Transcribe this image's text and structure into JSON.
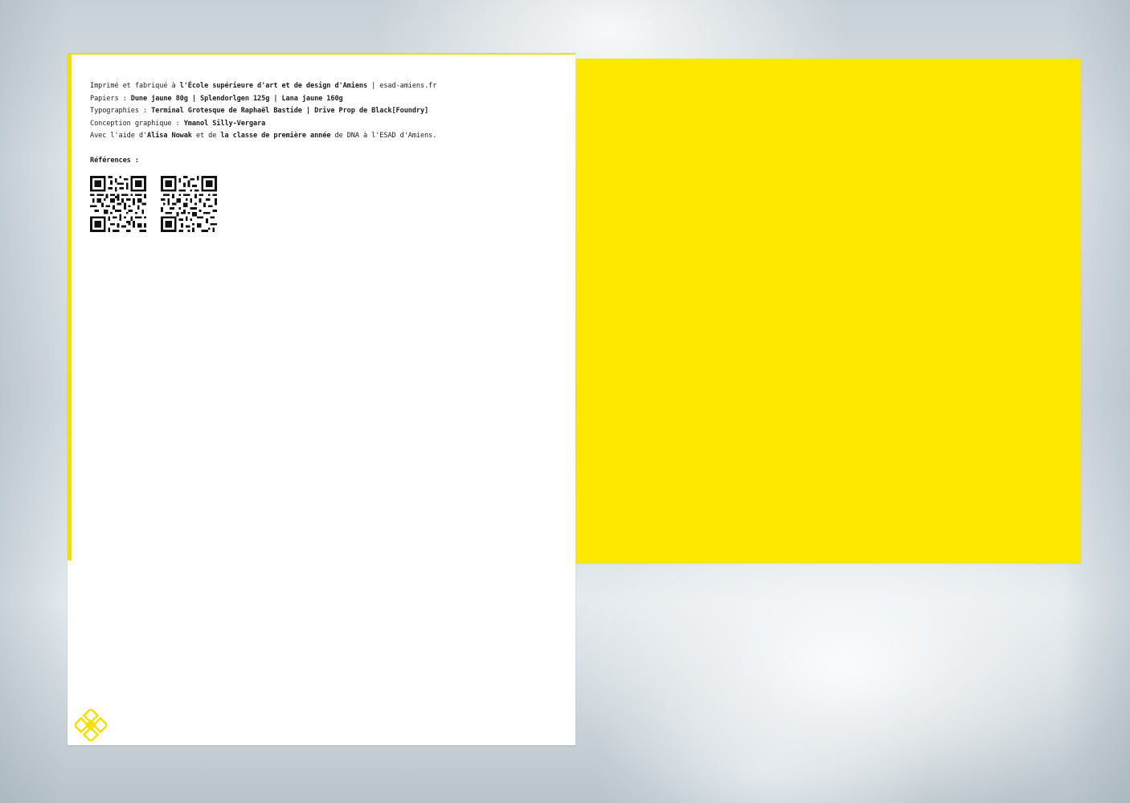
{
  "colophon": {
    "line1": {
      "t1": "Imprimé et fabriqué à ",
      "b1": "l'École supérieure d'art et de design d'Amiens",
      "t2": " | esad-amiens.fr"
    },
    "line2": {
      "t1": "Papiers : ",
      "b1": "Dune jaune 80g | Splendorlgen 125g | Lana jaune 160g"
    },
    "line3": {
      "t1": "Typographies : ",
      "b1": "Terminal Grotesque de Raphaël Bastide | Drive Prop de Black[Foundry]"
    },
    "line4": {
      "t1": "Conception graphique : ",
      "b1": "Ymanol Silly-Vergara"
    },
    "line5": {
      "t1": "Avec l'aide d'",
      "b1": "Alisa Nowak",
      "t2": " et de ",
      "b2": "la classe de première année",
      "t3": " de DNA à l'ESAD d'Amiens."
    },
    "references_label": "Références :"
  },
  "colors": {
    "yellow_page": "#ffe800",
    "logo_yellow": "#f5e100",
    "text": "#1c1c1c"
  },
  "icons": [
    "qr-code-icon",
    "qr-code-icon",
    "esad-logo-icon"
  ]
}
